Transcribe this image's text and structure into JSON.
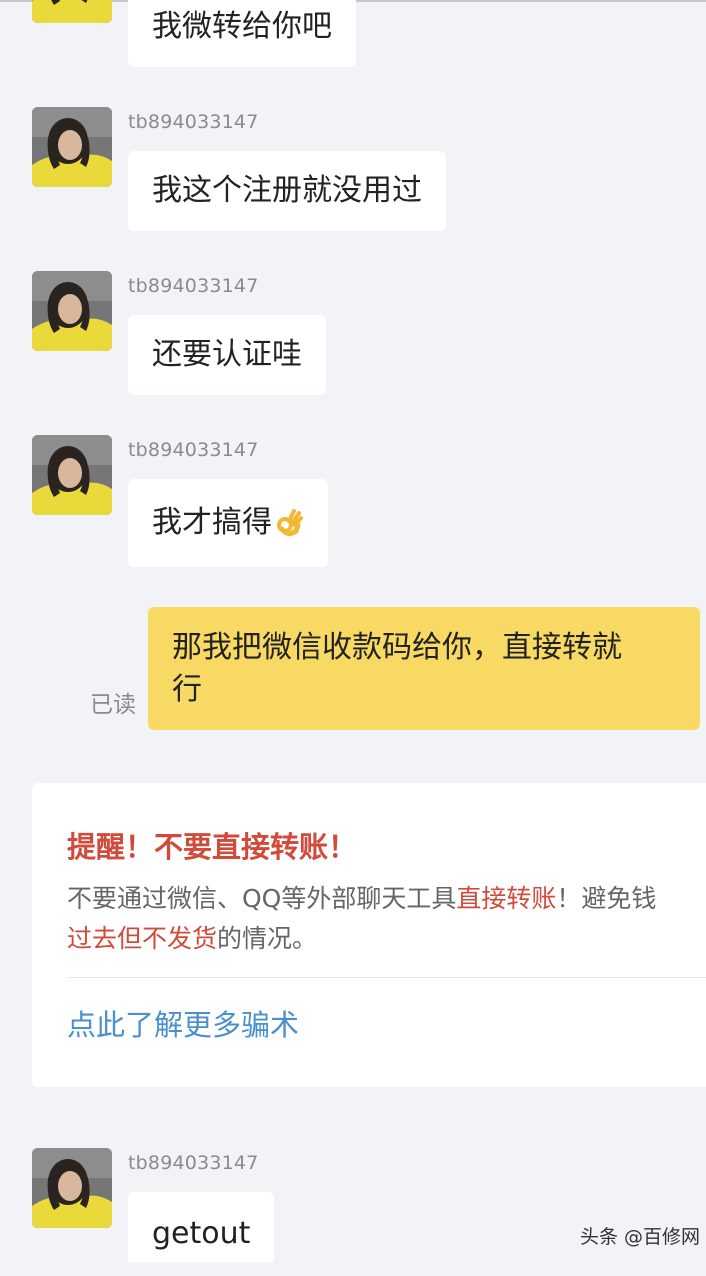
{
  "messages": [
    {
      "username": "",
      "text": "我微转给你吧"
    },
    {
      "username": "tb894033147",
      "text": "我这个注册就没用过"
    },
    {
      "username": "tb894033147",
      "text": "还要认证哇"
    },
    {
      "username": "tb894033147",
      "text": "我才搞得",
      "emoji": "ok-hand-emoji"
    },
    {
      "username": "tb894033147",
      "text": "getout"
    }
  ],
  "my_message": {
    "line1": "那我把微信收款码给你，直接转就",
    "line2": "行",
    "status": "已读"
  },
  "warning": {
    "title": "提醒！不要直接转账！",
    "text_part1": "不要通过微信、QQ等外部聊天工具",
    "text_part2": "直接转账",
    "text_part3": "！避免钱",
    "text_part4": "过去但不发货",
    "text_part5": "的情况。",
    "link": "点此了解更多骗术"
  },
  "watermark": "头条 @百修网",
  "colors": {
    "background": "#f2f3f7",
    "my_bubble": "#f8d964",
    "warning_red": "#d14b3a",
    "link_blue": "#4a8fce"
  }
}
